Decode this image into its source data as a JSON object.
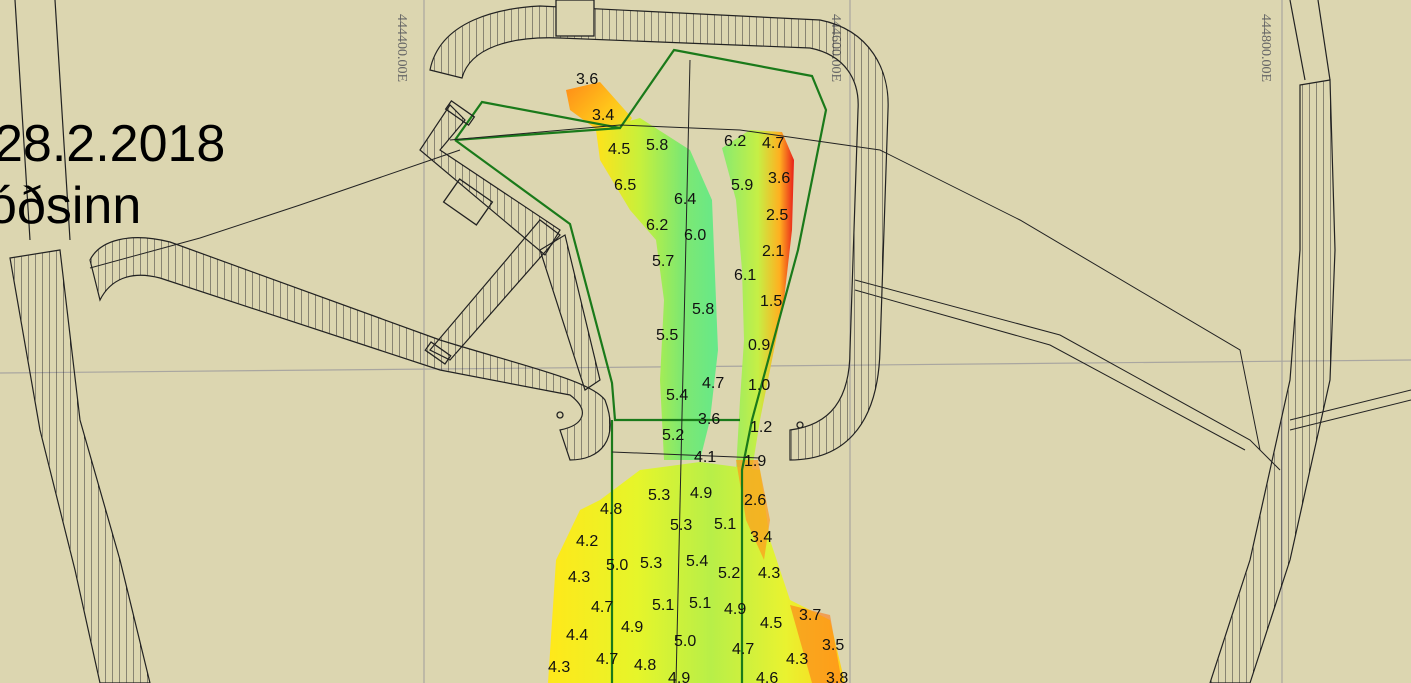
{
  "title": {
    "date": "28.2.2018",
    "place": "óðsinn"
  },
  "grid_labels": [
    "444400.00E",
    "444600.00E",
    "444800.00E"
  ],
  "colors": {
    "background": "#dcd6b0",
    "structure_lines": "#222222",
    "survey_boundary": "#1a7a1a",
    "grid": "#a9a6a0",
    "depth_shallow": "#e8201a",
    "depth_mid": "#ffee22",
    "depth_deep": "#66e88a"
  },
  "depth_soundings": [
    "3.6",
    "3.4",
    "4.5",
    "5.8",
    "6.2",
    "4.7",
    "6.5",
    "5.9",
    "3.6",
    "6.4",
    "2.5",
    "6.2",
    "6.0",
    "2.1",
    "5.7",
    "6.1",
    "5.8",
    "1.5",
    "5.5",
    "0.9",
    "4.7",
    "5.4",
    "1.0",
    "3.6",
    "1.2",
    "5.2",
    "4.1",
    "1.9",
    "5.3",
    "4.9",
    "2.6",
    "4.8",
    "5.3",
    "5.1",
    "3.4",
    "4.2",
    "5.0",
    "5.3",
    "5.4",
    "5.2",
    "4.3",
    "4.3",
    "4.7",
    "5.1",
    "5.1",
    "4.9",
    "3.7",
    "4.4",
    "4.9",
    "4.5",
    "3.5",
    "5.0",
    "4.7",
    "4.3",
    "4.3",
    "4.7",
    "4.8",
    "4.9",
    "4.6",
    "3.8"
  ]
}
